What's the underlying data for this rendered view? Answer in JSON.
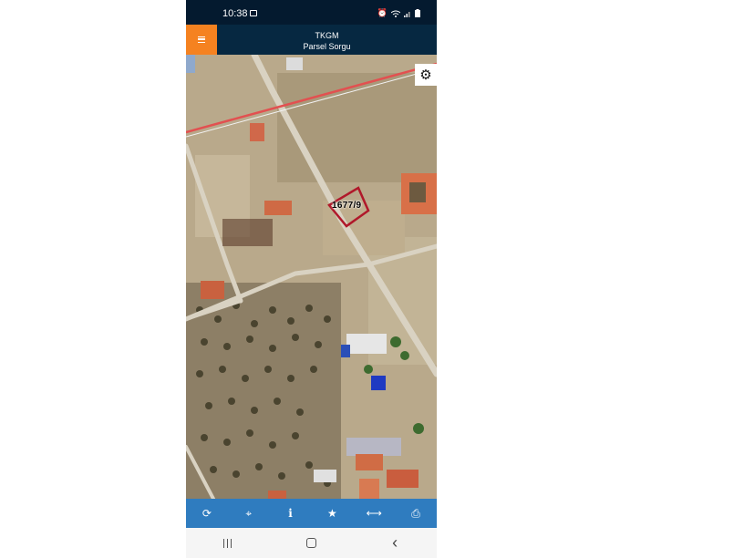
{
  "status_bar": {
    "time": "10:38",
    "icons": [
      "image-icon",
      "alarm-icon",
      "wifi-icon",
      "signal-icon",
      "battery-icon"
    ]
  },
  "app_bar": {
    "title": "TKGM",
    "subtitle": "Parsel Sorgu",
    "menu_icon": "hamburger-menu-icon",
    "accent_color": "#f58220",
    "background_color": "#062841"
  },
  "map": {
    "parcel_label": "1677/9",
    "parcel_color": "#b0182a",
    "settings_icon": "gear-icon"
  },
  "toolbar": {
    "background_color": "#2f7cbf",
    "items": [
      {
        "icon": "refresh-icon",
        "glyph": "⟳"
      },
      {
        "icon": "locate-icon",
        "glyph": "⌖"
      },
      {
        "icon": "info-icon",
        "glyph": "i"
      },
      {
        "icon": "star-icon",
        "glyph": "★"
      },
      {
        "icon": "measure-icon",
        "glyph": "⟷"
      },
      {
        "icon": "print-icon",
        "glyph": "⎙"
      }
    ]
  },
  "nav_bar": {
    "back_glyph": "‹"
  }
}
